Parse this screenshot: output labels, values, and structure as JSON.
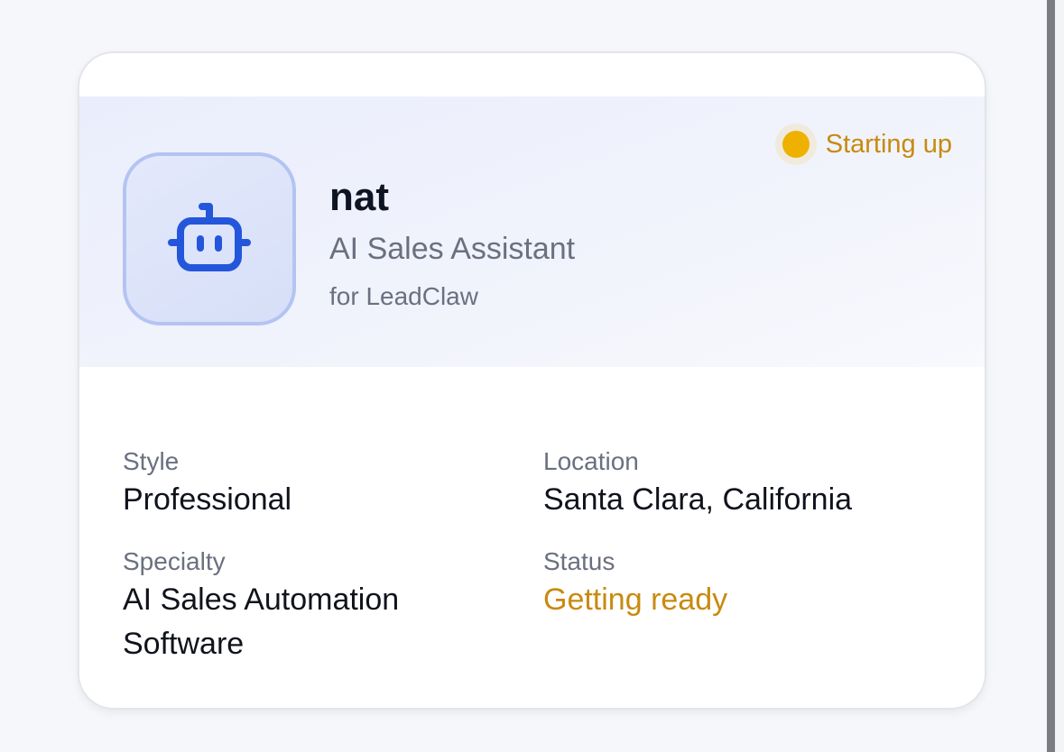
{
  "agent": {
    "name": "nat",
    "role": "AI Sales Assistant",
    "company": "for LeadClaw",
    "avatar_icon": "robot-icon",
    "status": "Starting up",
    "status_color": "#efb100"
  },
  "details": {
    "style_label": "Style",
    "style_value": "Professional",
    "location_label": "Location",
    "location_value": "Santa Clara, California",
    "specialty_label": "Specialty",
    "specialty_value": "AI Sales Automation Software",
    "status_label": "Status",
    "status_value": "Getting ready"
  },
  "colors": {
    "accent": "#2456dc",
    "warning": "#c88a10"
  }
}
